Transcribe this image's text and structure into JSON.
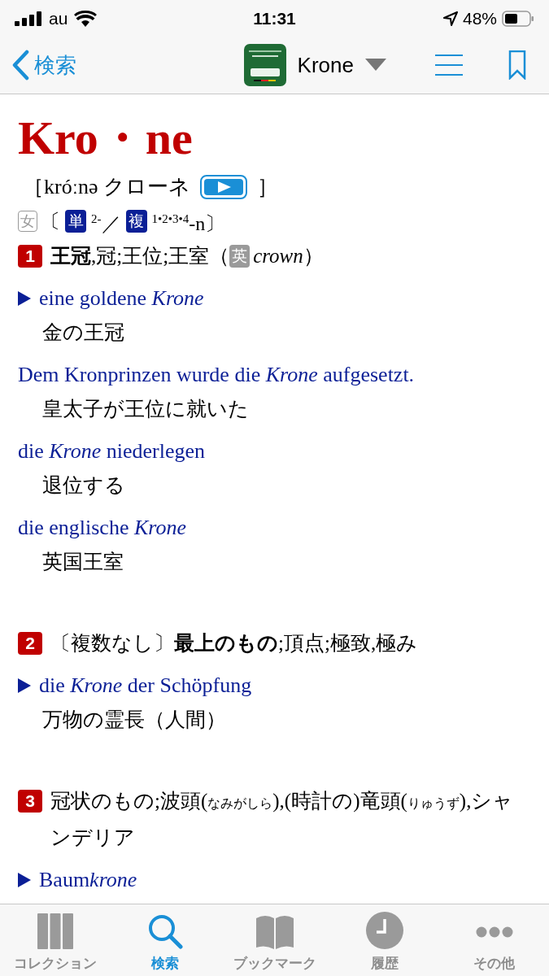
{
  "status_bar": {
    "carrier": "au",
    "time": "11:31",
    "battery": "48%"
  },
  "nav": {
    "back": "検索",
    "title": "Krone"
  },
  "entry": {
    "headword": "Kro・ne",
    "pronunciation": "［króːnə クローネ",
    "pronunciation_end": "］",
    "grammar": {
      "gender": "女",
      "open": "〔",
      "singular_badge": "単",
      "singular": "$^{2-}$／",
      "plural_badge": "複",
      "plural": "$^{1•2•3•4}$-n〕"
    },
    "senses": [
      {
        "number": "1",
        "definition": [
          {
            "kind": "text",
            "text": "**王冠**,冠;王位;王室（"
          },
          {
            "kind": "badge",
            "text": "英"
          },
          {
            "kind": "text",
            "text": "*crown*）"
          }
        ],
        "examples": [
          {
            "linked": true,
            "de": "eine goldene *Krone*",
            "ja": "金の王冠"
          },
          {
            "linked": false,
            "de": "Dem Kronprinzen wurde die *Krone* aufgesetzt.",
            "ja": "皇太子が王位に就いた"
          },
          {
            "linked": false,
            "de": "die *Krone* niederlegen",
            "ja": "退位する"
          },
          {
            "linked": false,
            "de": "die englische *Krone*",
            "ja": "英国王室"
          }
        ]
      },
      {
        "number": "2",
        "definition": [
          {
            "kind": "text",
            "text": "〔複数なし〕**最上のもの**;頂点;極致,極み"
          }
        ],
        "examples": [
          {
            "linked": true,
            "de": "die *Krone* der Schöpfung",
            "ja": "万物の霊長（人間）"
          }
        ]
      },
      {
        "number": "3",
        "definition": [
          {
            "kind": "text",
            "text": "冠状のもの;波頭("
          },
          {
            "kind": "ruby",
            "text": "なみがしら"
          },
          {
            "kind": "text",
            "text": "),(時計の)竜頭("
          },
          {
            "kind": "ruby",
            "text": "りゅうず"
          },
          {
            "kind": "text",
            "text": "),シャンデリア"
          }
        ],
        "examples": [
          {
            "linked": true,
            "de": "Baum",
            "de_italic": "krone"
          }
        ]
      }
    ]
  },
  "tabs": [
    {
      "kind": "books",
      "label": "コレクション",
      "selected": false
    },
    {
      "kind": "search",
      "label": "検索",
      "selected": true
    },
    {
      "kind": "book",
      "label": "ブックマーク",
      "selected": false
    },
    {
      "kind": "clock",
      "label": "履歴",
      "selected": false
    },
    {
      "kind": "dots",
      "label": "その他",
      "selected": false
    }
  ]
}
